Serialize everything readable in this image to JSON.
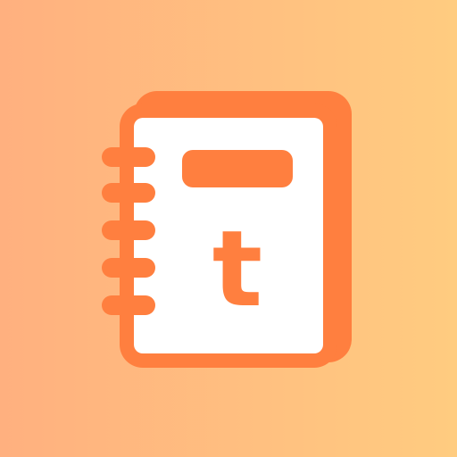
{
  "app_icon": {
    "letter": "t",
    "icon_name": "notebook-icon",
    "colors": {
      "background_start": "#FFB07F",
      "background_end": "#FFCC80",
      "accent": "#FF7F3F",
      "page": "#FFFFFF"
    }
  }
}
